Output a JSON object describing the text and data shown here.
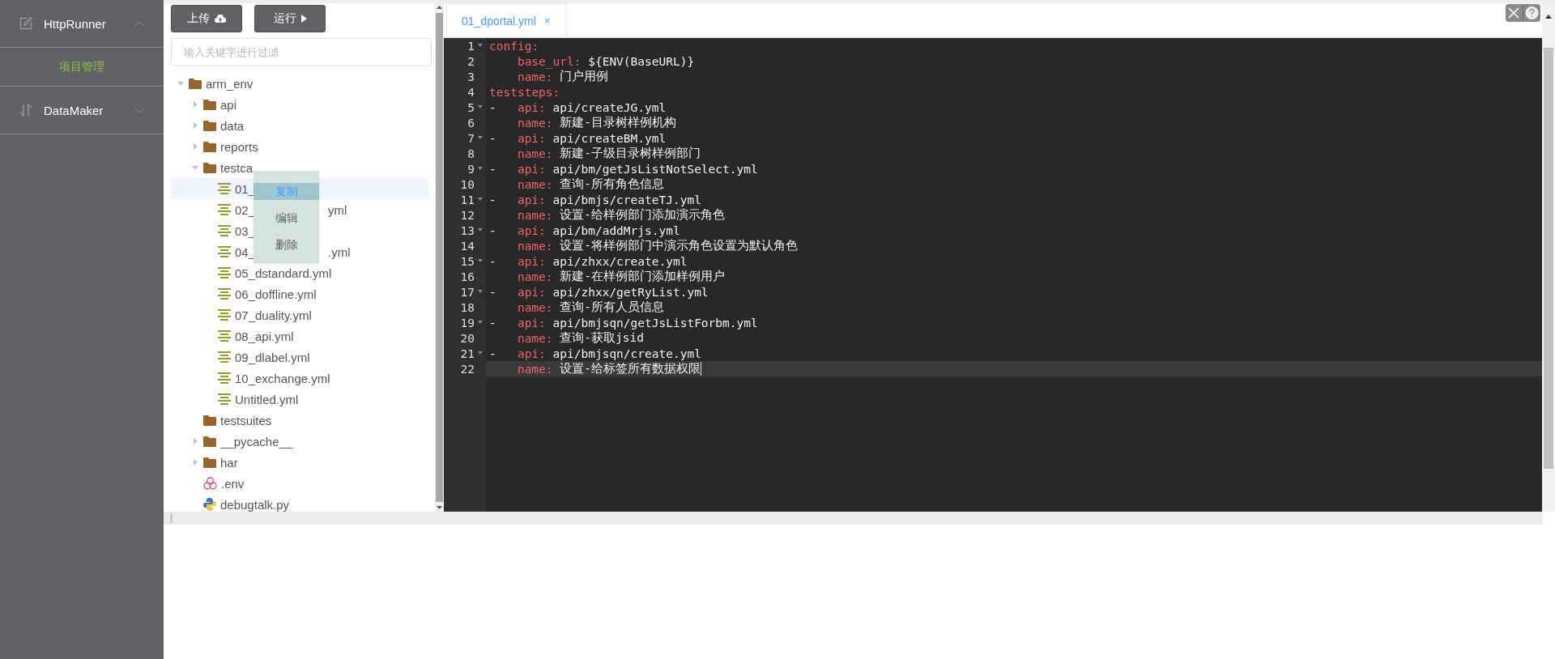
{
  "sidebar": {
    "groups": [
      {
        "label": "HttpRunner",
        "expanded": true,
        "items": [
          {
            "label": "项目管理",
            "selected": true
          }
        ]
      },
      {
        "label": "DataMaker",
        "expanded": false
      }
    ]
  },
  "toolbar": {
    "buttons": [
      {
        "label": "上传"
      },
      {
        "label": "运行"
      }
    ]
  },
  "filter": {
    "placeholder": "输入关键字进行过滤"
  },
  "tree": [
    {
      "label": "arm_env",
      "kind": "folder",
      "expanded": true,
      "children": [
        {
          "label": "api",
          "kind": "folder",
          "expanded": false
        },
        {
          "label": "data",
          "kind": "folder",
          "expanded": false
        },
        {
          "label": "reports",
          "kind": "folder",
          "expanded": false
        },
        {
          "label": "testca",
          "kind": "folder",
          "expanded": true,
          "children": [
            {
              "label": "01_",
              "kind": "yml",
              "selected": true
            },
            {
              "label": "02_",
              "tail": "yml",
              "kind": "yml",
              "selected": false
            },
            {
              "label": "03_",
              "kind": "yml",
              "selected": false
            },
            {
              "label": "04_",
              "tail": ".yml",
              "kind": "yml",
              "selected": false
            },
            {
              "label": "05_dstandard.yml",
              "kind": "yml",
              "selected": false
            },
            {
              "label": "06_doffline.yml",
              "kind": "yml",
              "selected": false
            },
            {
              "label": "07_duality.yml",
              "kind": "yml",
              "selected": false
            },
            {
              "label": "08_api.yml",
              "kind": "yml",
              "selected": false
            },
            {
              "label": "09_dlabel.yml",
              "kind": "yml",
              "selected": false
            },
            {
              "label": "10_exchange.yml",
              "kind": "yml",
              "selected": false
            },
            {
              "label": "Untitled.yml",
              "kind": "yml",
              "selected": false
            }
          ]
        },
        {
          "label": "testsuites",
          "kind": "folder"
        },
        {
          "label": "__pycache__",
          "kind": "folder",
          "expanded": false
        },
        {
          "label": "har",
          "kind": "folder",
          "expanded": false
        },
        {
          "label": ".env",
          "kind": "env"
        },
        {
          "label": "debugtalk.py",
          "kind": "py"
        }
      ]
    }
  ],
  "context_menu": [
    {
      "label": "复制",
      "selected": true
    },
    {
      "label": "编辑",
      "selected": false
    },
    {
      "label": "删除",
      "selected": false
    }
  ],
  "editor": {
    "tabs": [
      {
        "label": "01_dportal.yml",
        "close": "×",
        "selected": true
      }
    ],
    "lines": [
      {
        "number": "1",
        "fold": true,
        "kind": "top",
        "key": "config:"
      },
      {
        "number": "2",
        "fold": false,
        "kind": "field",
        "key": "base_url:",
        "value": "${ENV(BaseURL)}"
      },
      {
        "number": "3",
        "fold": false,
        "kind": "field",
        "key": "name:",
        "value": "门户用例"
      },
      {
        "number": "4",
        "fold": false,
        "kind": "top",
        "key": "teststeps:"
      },
      {
        "number": "5",
        "fold": true,
        "kind": "field",
        "dash": "-",
        "key": "api:",
        "value": "api/createJG.yml"
      },
      {
        "number": "6",
        "fold": false,
        "kind": "field",
        "key": "name:",
        "value": "新建-目录树样例机构"
      },
      {
        "number": "7",
        "fold": true,
        "kind": "field",
        "dash": "-",
        "key": "api:",
        "value": "api/createBM.yml"
      },
      {
        "number": "8",
        "fold": false,
        "kind": "field",
        "key": "name:",
        "value": "新建-子级目录树样例部门"
      },
      {
        "number": "9",
        "fold": true,
        "kind": "field",
        "dash": "-",
        "key": "api:",
        "value": "api/bm/getJsListNotSelect.yml"
      },
      {
        "number": "10",
        "fold": false,
        "kind": "field",
        "key": "name:",
        "value": "查询-所有角色信息"
      },
      {
        "number": "11",
        "fold": true,
        "kind": "field",
        "dash": "-",
        "key": "api:",
        "value": "api/bmjs/createTJ.yml"
      },
      {
        "number": "12",
        "fold": false,
        "kind": "field",
        "key": "name:",
        "value": "设置-给样例部门添加演示角色"
      },
      {
        "number": "13",
        "fold": true,
        "kind": "field",
        "dash": "-",
        "key": "api:",
        "value": "api/bm/addMrjs.yml"
      },
      {
        "number": "14",
        "fold": false,
        "kind": "field",
        "key": "name:",
        "value": "设置-将样例部门中演示角色设置为默认角色"
      },
      {
        "number": "15",
        "fold": true,
        "kind": "field",
        "dash": "-",
        "key": "api:",
        "value": "api/zhxx/create.yml"
      },
      {
        "number": "16",
        "fold": false,
        "kind": "field",
        "key": "name:",
        "value": "新建-在样例部门添加样例用户"
      },
      {
        "number": "17",
        "fold": true,
        "kind": "field",
        "dash": "-",
        "key": "api:",
        "value": "api/zhxx/getRyList.yml"
      },
      {
        "number": "18",
        "fold": false,
        "kind": "field",
        "key": "name:",
        "value": "查询-所有人员信息"
      },
      {
        "number": "19",
        "fold": true,
        "kind": "field",
        "dash": "-",
        "key": "api:",
        "value": "api/bmjsqn/getJsListForbm.yml"
      },
      {
        "number": "20",
        "fold": false,
        "kind": "field",
        "key": "name:",
        "value": "查询-获取jsid"
      },
      {
        "number": "21",
        "fold": true,
        "kind": "field",
        "dash": "-",
        "key": "api:",
        "value": "api/bmjsqn/create.yml"
      },
      {
        "number": "22",
        "fold": false,
        "kind": "field",
        "key": "name:",
        "value": "设置-给标签所有数据权限",
        "current": true
      }
    ]
  }
}
